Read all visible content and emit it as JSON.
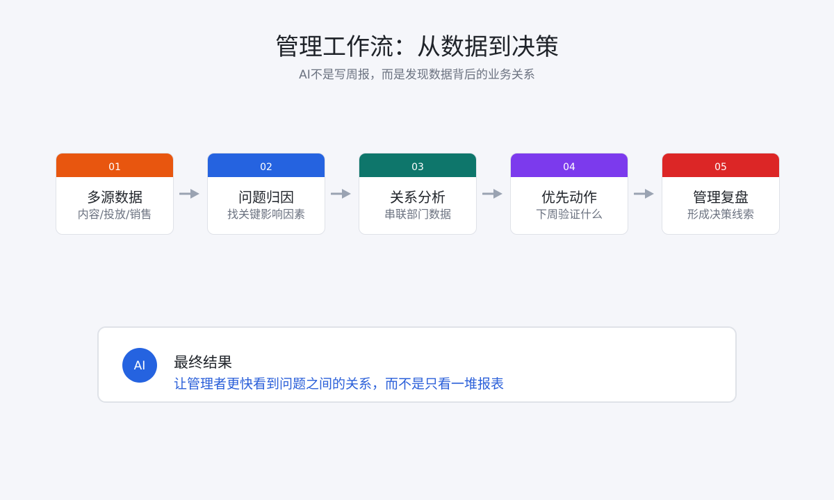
{
  "header": {
    "title": "管理工作流：从数据到决策",
    "subtitle": "AI不是写周报，而是发现数据背后的业务关系"
  },
  "colors": {
    "background": "#f5f6fa",
    "card_border": "#dfe2e8",
    "arrow": "#9aa3b2",
    "accent_blue": "#2a5fd9"
  },
  "steps": [
    {
      "number": "01",
      "title": "多源数据",
      "subtitle": "内容/投放/销售",
      "color": "#e8560f"
    },
    {
      "number": "02",
      "title": "问题归因",
      "subtitle": "找关键影响因素",
      "color": "#2563e0"
    },
    {
      "number": "03",
      "title": "关系分析",
      "subtitle": "串联部门数据",
      "color": "#0e766b"
    },
    {
      "number": "04",
      "title": "优先动作",
      "subtitle": "下周验证什么",
      "color": "#7c3aed"
    },
    {
      "number": "05",
      "title": "管理复盘",
      "subtitle": "形成决策线索",
      "color": "#dc2626"
    }
  ],
  "result": {
    "avatar_text": "AI",
    "title": "最终结果",
    "text": "让管理者更快看到问题之间的关系，而不是只看一堆报表",
    "avatar_color": "#2563e0",
    "text_color": "#2a5fd9"
  }
}
